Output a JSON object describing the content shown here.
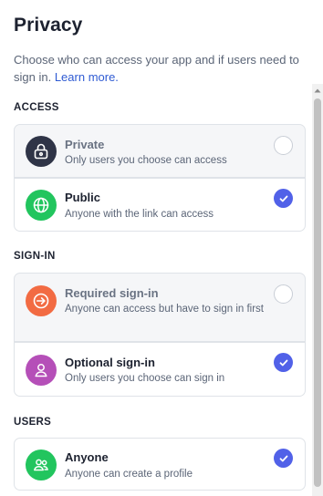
{
  "header": {
    "title": "Privacy",
    "description": "Choose who can access your app and if users need to sign in.",
    "learn_more": "Learn more."
  },
  "sections": {
    "access": {
      "label": "ACCESS",
      "options": [
        {
          "label": "Private",
          "sub": "Only users you choose can access",
          "selected": false,
          "icon": "lock-icon",
          "icon_color": "#2f3447"
        },
        {
          "label": "Public",
          "sub": "Anyone with the link can access",
          "selected": true,
          "icon": "globe-icon",
          "icon_color": "#22c55e"
        }
      ]
    },
    "signin": {
      "label": "SIGN-IN",
      "options": [
        {
          "label": "Required sign-in",
          "sub": "Anyone can access but have to sign in first",
          "selected": false,
          "icon": "sign-in-arrow-icon",
          "icon_color": "#f26b43"
        },
        {
          "label": "Optional sign-in",
          "sub": "Only users you choose can sign in",
          "selected": true,
          "icon": "user-icon",
          "icon_color": "#b54fb8"
        }
      ]
    },
    "users": {
      "label": "USERS",
      "options": [
        {
          "label": "Anyone",
          "sub": "Anyone can create a profile",
          "selected": true,
          "icon": "users-icon",
          "icon_color": "#22c55e"
        }
      ]
    }
  },
  "colors": {
    "accent": "#5161e8",
    "link": "#2f5bd3",
    "muted_card": "#f5f6f8",
    "border": "#dfe3e8"
  }
}
